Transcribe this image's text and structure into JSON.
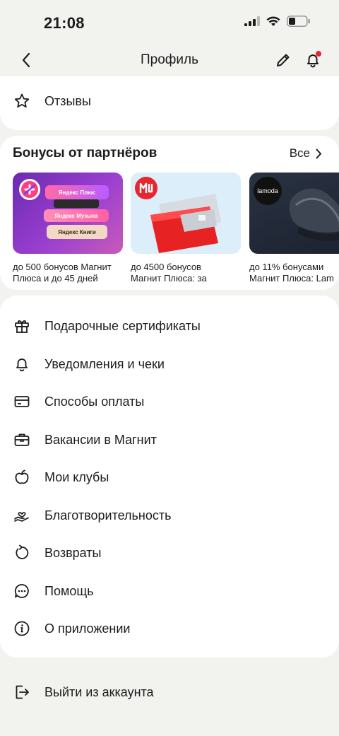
{
  "status_bar": {
    "time": "21:08"
  },
  "nav": {
    "title": "Профиль"
  },
  "reviews": {
    "label": "Отзывы"
  },
  "bonuses": {
    "title": "Бонусы от партнёров",
    "all_label": "Все",
    "tiles": [
      {
        "line1": "до 500 бонусов Магнит",
        "line2": "Плюса и до 45 дней",
        "promo": [
          "Яндекс Плюс",
          "Яндекс Музыка",
          "Яндекс Книги"
        ]
      },
      {
        "line1": "до 4500 бонусов",
        "line2": "Магнит Плюса: за"
      },
      {
        "line1": "до 11% бонусами",
        "line2": "Магнит Плюса: Lam",
        "brand": "lamoda"
      }
    ]
  },
  "menu": {
    "items": [
      {
        "label": "Подарочные сертификаты",
        "icon": "gift-icon"
      },
      {
        "label": "Уведомления и чеки",
        "icon": "bell-icon"
      },
      {
        "label": "Способы оплаты",
        "icon": "card-icon"
      },
      {
        "label": "Вакансии в Магнит",
        "icon": "briefcase-icon"
      },
      {
        "label": "Мои клубы",
        "icon": "apple-icon"
      },
      {
        "label": "Благотворительность",
        "icon": "charity-icon"
      },
      {
        "label": "Возвраты",
        "icon": "return-icon"
      },
      {
        "label": "Помощь",
        "icon": "chat-icon"
      },
      {
        "label": "О приложении",
        "icon": "info-icon"
      }
    ]
  },
  "logout": {
    "label": "Выйти из аккаунта",
    "icon": "logout-icon"
  },
  "colors": {
    "background": "#f2f2ef",
    "card": "#ffffff",
    "accent": "#e8262f"
  }
}
